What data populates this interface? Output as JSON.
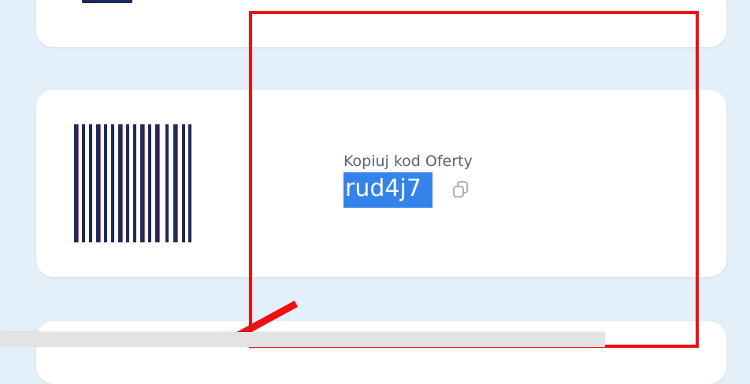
{
  "offer": {
    "copy_label": "Kopiuj kod Oferty",
    "code": "rud4j7",
    "copy_icon": "copy-icon",
    "barcode_icon": "barcode-icon"
  },
  "annotation": {
    "box_color": "#ee1111",
    "arrow_color": "#ee1111"
  },
  "colors": {
    "page_background": "#e3f0fa",
    "card_background": "#ffffff",
    "selection_highlight": "#3483ea",
    "barcode_bars": "#1e2a5a",
    "barcode_accent": "#c0303a"
  }
}
